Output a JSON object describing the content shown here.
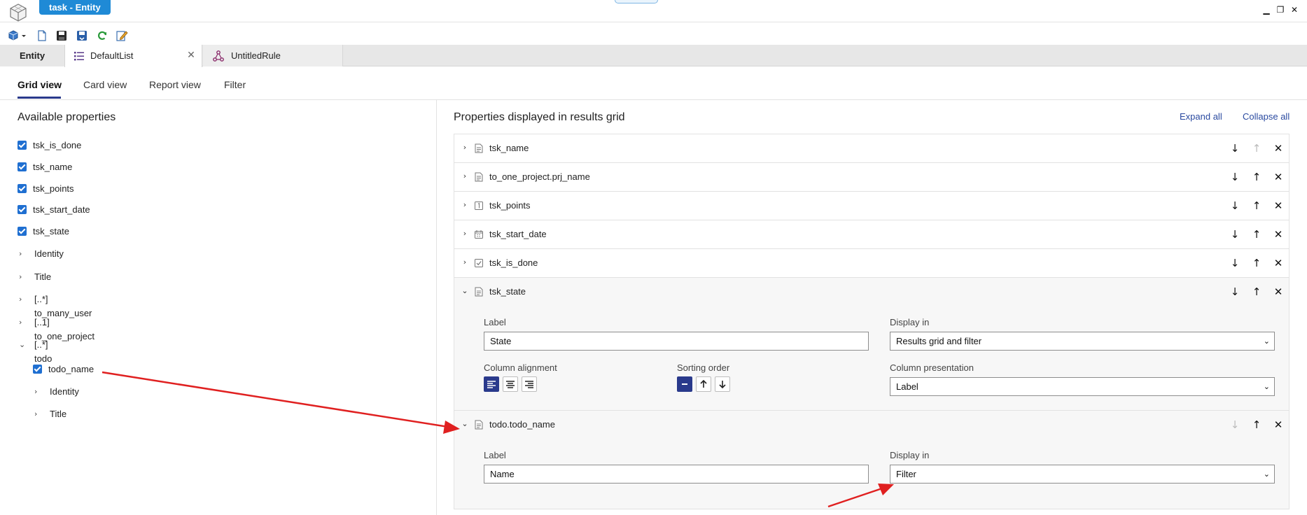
{
  "window": {
    "title": "task - Entity",
    "controls": {
      "minimize": "▁",
      "restore": "❐",
      "close": "✕"
    }
  },
  "toolbar": {
    "icons": [
      "publish-icon",
      "new-icon",
      "save-icon",
      "save-close-icon",
      "refresh-icon",
      "edit-icon"
    ]
  },
  "doc_tabs": [
    {
      "label": "Entity",
      "icon": ""
    },
    {
      "label": "DefaultList",
      "icon": "list-icon",
      "closable": true
    },
    {
      "label": "UntitledRule",
      "icon": "rule-icon"
    }
  ],
  "view_tabs": [
    "Grid view",
    "Card view",
    "Report view",
    "Filter"
  ],
  "left": {
    "title": "Available properties",
    "checked": [
      "tsk_is_done",
      "tsk_name",
      "tsk_points",
      "tsk_start_date",
      "tsk_state"
    ],
    "groups": [
      "Identity",
      "Title",
      "[..*] to_many_user",
      "[..1] to_one_project",
      "[..*] todo"
    ],
    "todo_children": {
      "checked": [
        "todo_name"
      ],
      "groups": [
        "Identity",
        "Title"
      ]
    }
  },
  "right": {
    "title": "Properties displayed in results grid",
    "expand_all": "Expand all",
    "collapse_all": "Collapse all",
    "rows": [
      {
        "name": "tsk_name",
        "icon": "text-field-icon"
      },
      {
        "name": "to_one_project.prj_name",
        "icon": "text-field-icon"
      },
      {
        "name": "tsk_points",
        "icon": "number-field-icon"
      },
      {
        "name": "tsk_start_date",
        "icon": "date-field-icon"
      },
      {
        "name": "tsk_is_done",
        "icon": "boolean-field-icon"
      },
      {
        "name": "tsk_state",
        "icon": "text-field-icon"
      },
      {
        "name": "todo.todo_name",
        "icon": "text-field-icon"
      }
    ],
    "state_detail": {
      "label_caption": "Label",
      "label_value": "State",
      "display_caption": "Display in",
      "display_value": "Results grid and filter",
      "alignment_caption": "Column alignment",
      "sorting_caption": "Sorting order",
      "presentation_caption": "Column presentation",
      "presentation_value": "Label"
    },
    "todo_detail": {
      "label_caption": "Label",
      "label_value": "Name",
      "display_caption": "Display in",
      "display_value": "Filter"
    }
  },
  "glyphs": {
    "chev_right": "›",
    "chev_down": "⌄",
    "down": "↓",
    "up": "↑",
    "remove": "✕",
    "close_tab": "✕",
    "select_caret": "⌄"
  },
  "colors": {
    "accent": "#1f8ad6",
    "active_tab_underline": "#2a3a8c",
    "checkbox": "#1f6fd1",
    "link": "#2a4aa0",
    "annotation_arrow": "#e02020"
  }
}
